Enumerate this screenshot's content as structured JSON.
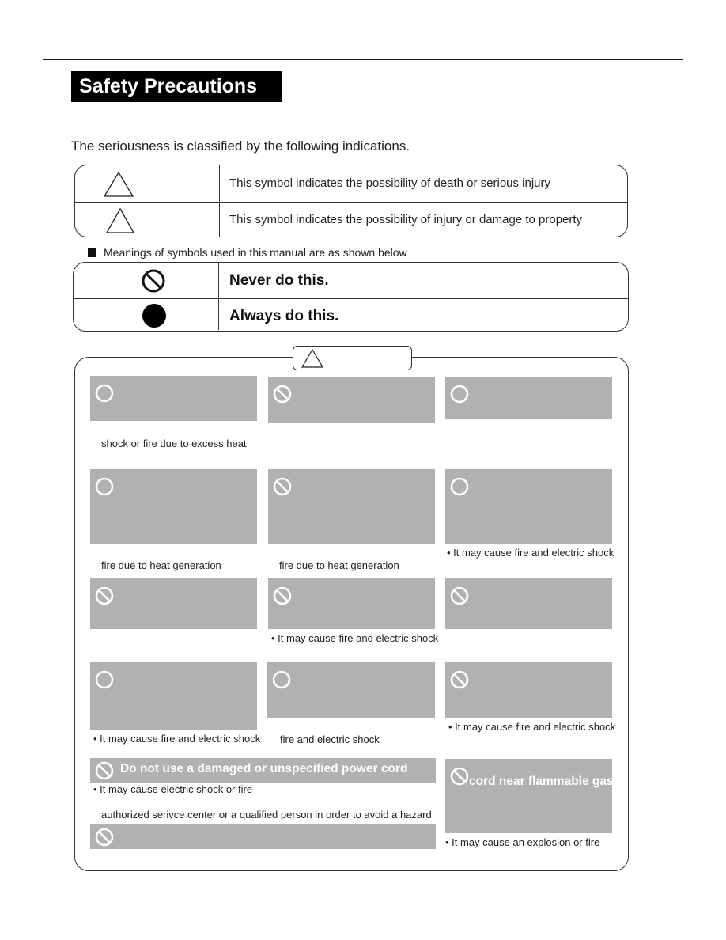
{
  "page": {
    "title": "Safety Precautions",
    "intro": "The seriousness is classified by the following indications."
  },
  "indications": [
    {
      "icon": "warning-triangle-icon",
      "text": "This symbol indicates the possibility of death or serious injury"
    },
    {
      "icon": "caution-triangle-icon",
      "text": "This symbol indicates the possibility of injury or damage to property"
    }
  ],
  "meanings": {
    "heading": "Meanings of symbols used in this manual are as shown below",
    "rows": [
      {
        "icon": "prohibited-icon",
        "text": "Never do this."
      },
      {
        "icon": "mandatory-filled-circle-icon",
        "text": "Always do this."
      }
    ]
  },
  "warning_section": {
    "label_icon": "warning-triangle-icon",
    "cards": [
      {
        "icon": "mandatory-circle-icon",
        "title": "",
        "caption": "shock or fire due to excess heat"
      },
      {
        "icon": "prohibited-icon",
        "title": "",
        "caption": ""
      },
      {
        "icon": "mandatory-circle-icon",
        "title": "",
        "caption": ""
      },
      {
        "icon": "mandatory-circle-icon",
        "title": "",
        "caption": "fire due to heat generation"
      },
      {
        "icon": "prohibited-icon",
        "title": "",
        "caption": "fire due to heat generation"
      },
      {
        "icon": "mandatory-circle-icon",
        "title": "",
        "caption": "• It may cause fire and electric shock"
      },
      {
        "icon": "prohibited-icon",
        "title": "",
        "caption": ""
      },
      {
        "icon": "prohibited-icon",
        "title": "",
        "caption": "• It may cause fire and electric shock"
      },
      {
        "icon": "prohibited-icon",
        "title": "",
        "caption": ""
      },
      {
        "icon": "mandatory-circle-icon",
        "title": "",
        "caption": "• It may cause fire and electric shock"
      },
      {
        "icon": "mandatory-circle-icon",
        "title": "",
        "caption": "fire and electric shock"
      },
      {
        "icon": "prohibited-icon",
        "title": "",
        "caption": "• It may cause fire and electric shock"
      },
      {
        "icon": "prohibited-icon",
        "title": "Do not use a damaged or unspecified power cord",
        "caption": "• It may cause electric shock or fire",
        "caption2": "authorized serivce center or a qualified person in order to avoid a hazard"
      },
      {
        "icon": "prohibited-icon",
        "title": "cord near flammable gas",
        "caption": "• It may cause an explosion or fire"
      },
      {
        "icon": "prohibited-icon",
        "title": "",
        "caption": ""
      }
    ]
  }
}
